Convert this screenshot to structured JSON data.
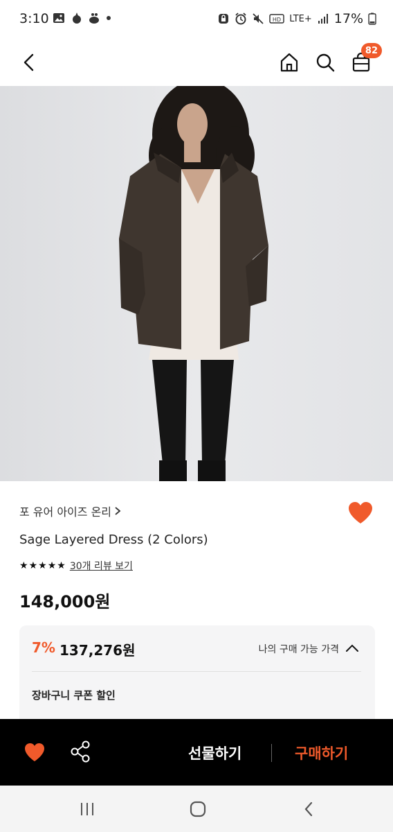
{
  "status": {
    "time": "3:10",
    "network": "LTE+",
    "battery": "17%"
  },
  "header": {
    "cart_count": "82"
  },
  "product": {
    "brand": "포 유어 아이즈 온리",
    "name": "Sage Layered Dress (2 Colors)",
    "rating_stars": 5,
    "review_link": "30개 리뷰 보기",
    "price": "148,000원"
  },
  "discount": {
    "rate": "7%",
    "price": "137,276원",
    "my_price_label": "나의 구매 가능 가격",
    "coupon_label": "장바구니 쿠폰 할인"
  },
  "actions": {
    "gift_label": "선물하기",
    "buy_label": "구매하기"
  },
  "colors": {
    "accent": "#f05a2b",
    "bottom_bar": "#000000"
  }
}
